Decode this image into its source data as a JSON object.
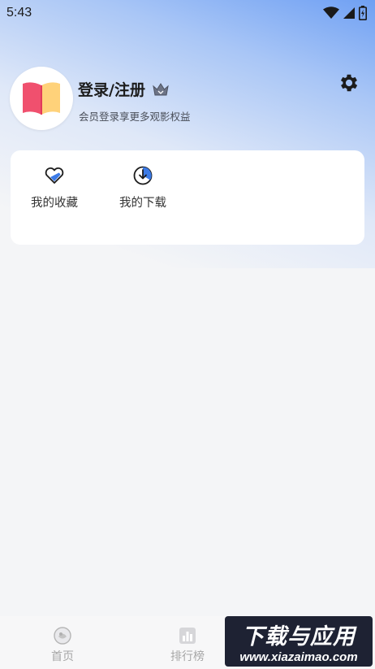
{
  "status_bar": {
    "time": "5:43",
    "icons": [
      "wifi-icon",
      "cellular-signal-icon",
      "battery-icon"
    ]
  },
  "profile": {
    "login_label": "登录/注册",
    "subtitle": "会员登录享更多观影权益",
    "icons": [
      "book-logo-icon",
      "crown-icon",
      "gear-icon"
    ]
  },
  "quick_actions": [
    {
      "label": "我的收藏",
      "icon": "heart-icon"
    },
    {
      "label": "我的下载",
      "icon": "download-icon"
    }
  ],
  "bottom_nav": [
    {
      "label": "首页",
      "icon": "home-icon"
    },
    {
      "label": "排行榜",
      "icon": "ranking-icon"
    }
  ],
  "watermark": {
    "title": "下载与应用",
    "url": "www.xiazaimao.com"
  },
  "colors": {
    "accent": "#3b7ae6",
    "background": "#f4f5f7",
    "card": "#ffffff",
    "tab_text": "#a6a6a6"
  }
}
